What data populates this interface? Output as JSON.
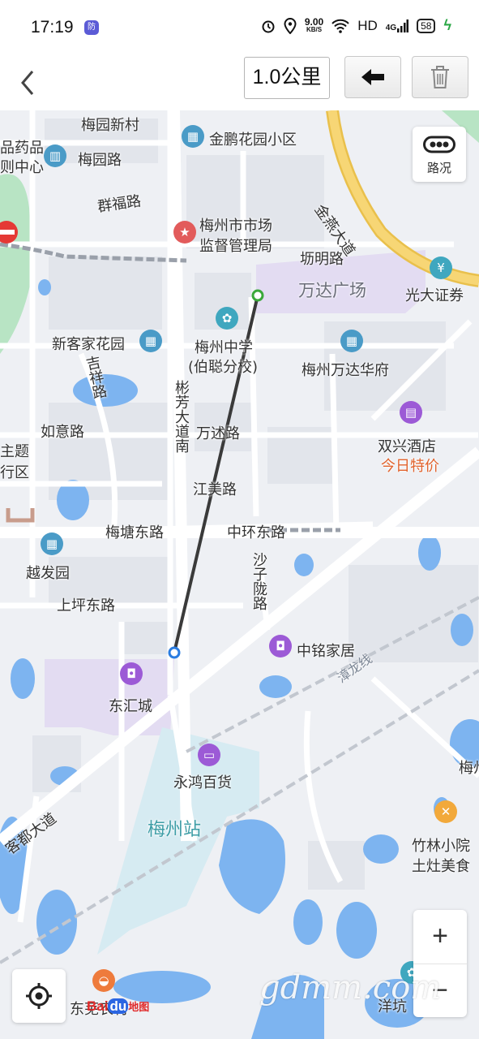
{
  "status_bar": {
    "time": "17:19",
    "badge": "防",
    "net_speed_value": "9.00",
    "net_speed_unit": "KB/S",
    "hd": "HD",
    "signal": "4G",
    "battery": "58"
  },
  "toolbar": {
    "distance": "1.0公里"
  },
  "map": {
    "traffic_label": "路况",
    "zoom_in": "+",
    "zoom_out": "−",
    "baidu_logo": {
      "bai": "Bai",
      "du": "du",
      "ditu": "地图"
    },
    "watermark": "gdmm.com",
    "labels": {
      "meiyuan_xincun": "梅园新村",
      "jinpeng_huayuan": "金鹏花园小区",
      "yaopin": "品药品",
      "zhongxin": "则中心",
      "meiyuan_lu": "梅园路",
      "qunfu_lu": "群福路",
      "jinyan_dadao": "金燕大道",
      "market_bureau_1": "梅州市市场",
      "market_bureau_2": "监督管理局",
      "fangming_lu": "坜明路",
      "wanda_plaza": "万达广场",
      "guangda_sec": "光大证券",
      "xinke_garden": "新客家花园",
      "meizhou_school_1": "梅州中学",
      "meizhou_school_2": "(伯聪分校)",
      "wanda_huafu": "梅州万达华府",
      "jixiang_lu": "吉祥路",
      "binfang_dadao": "彬芳大道南",
      "ruyi_lu": "如意路",
      "wanshu_lu": "万述路",
      "shuangxing_hotel": "双兴酒店",
      "today_price": "今日特价",
      "zhuti_1": "主题",
      "zhuti_2": "行区",
      "jiangmei_lu": "江美路",
      "meitang_donglu": "梅塘东路",
      "zhonghuan_donglu": "中环东路",
      "yuefa_yuan": "越发园",
      "shazi_longlu": "沙子陇路",
      "shangping_donglu": "上坪东路",
      "zhongming_jiaju": "中铭家居",
      "zhanglong_xian": "漳龙线",
      "donghui_cheng": "东汇城",
      "yonghong_baihuo": "永鸿百货",
      "meizhou_station": "梅州站",
      "kedu_dadao": "客都大道",
      "meizhou_right": "梅州",
      "zhulin_1": "竹林小院",
      "zhulin_2": "土灶美食",
      "dongyuan": "东芜农村",
      "yangkeng": "洋坑"
    }
  },
  "colors": {
    "route_line": "#3a3a3a",
    "route_start": "#3aa83a",
    "route_end": "#2a7ce0",
    "road_major": "#ffffff",
    "road_highway": "#f7d675",
    "water": "#7db4f0",
    "park": "#b8e4c4",
    "plaza": "#e3dcf2",
    "station_area": "#d6ebf2"
  }
}
